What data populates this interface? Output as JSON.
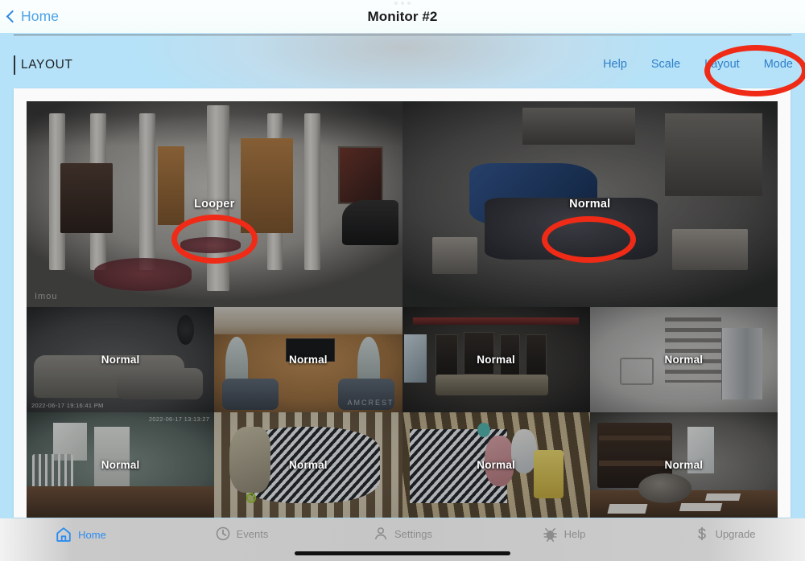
{
  "nav": {
    "back_label": "Home",
    "back_icon": "chevron-left-icon",
    "title": "Monitor #2"
  },
  "toolbar": {
    "section_label": "LAYOUT",
    "links": [
      {
        "label": "Help",
        "name": "help"
      },
      {
        "label": "Scale",
        "name": "scale"
      },
      {
        "label": "Layout",
        "name": "layout"
      },
      {
        "label": "Mode",
        "name": "mode"
      }
    ]
  },
  "camera_grid": {
    "rows": [
      {
        "height_class": "row-big",
        "tiles": [
          {
            "name": "camera-tile-foyer",
            "label": "Looper",
            "scene": "sc-foyer",
            "watermark": "Imou",
            "watermark_pos": "wm-bl",
            "corner_text": "",
            "corner_pos": "ts-tr"
          },
          {
            "name": "camera-tile-bedroom",
            "label": "Normal",
            "scene": "sc-bedroom",
            "watermark": "",
            "watermark_pos": "wm-bl",
            "corner_text": "",
            "corner_pos": "ts-tr"
          }
        ]
      },
      {
        "height_class": "row-sm",
        "tiles": [
          {
            "name": "camera-tile-living-room-gray",
            "label": "Normal",
            "scene": "sc-livgray",
            "watermark": "",
            "watermark_pos": "wm-bl",
            "corner_text": "2022-06-17 19:16:41 PM",
            "corner_pos": "ts-bl"
          },
          {
            "name": "camera-tile-family-room",
            "label": "Normal",
            "scene": "sc-tan",
            "watermark": "AMCREST",
            "watermark_pos": "wm-br",
            "corner_text": "",
            "corner_pos": "ts-bl"
          },
          {
            "name": "camera-tile-dining-room",
            "label": "Normal",
            "scene": "sc-dark",
            "watermark": "",
            "watermark_pos": "wm-bl",
            "corner_text": "",
            "corner_pos": "ts-tr"
          },
          {
            "name": "camera-tile-garage",
            "label": "Normal",
            "scene": "sc-garage",
            "watermark": "",
            "watermark_pos": "wm-bl",
            "corner_text": "",
            "corner_pos": "ts-tr"
          }
        ]
      },
      {
        "height_class": "row-sm",
        "tiles": [
          {
            "name": "camera-tile-nursery",
            "label": "Normal",
            "scene": "sc-nursery",
            "watermark": "",
            "watermark_pos": "wm-bl",
            "corner_text": "2022-06-17 13:13:27",
            "corner_pos": "ts-tr"
          },
          {
            "name": "camera-tile-crib-one",
            "label": "Normal",
            "scene": "sc-crib",
            "watermark": "",
            "watermark_pos": "wm-bl",
            "corner_text": "",
            "corner_pos": "ts-tr"
          },
          {
            "name": "camera-tile-crib-two",
            "label": "Normal",
            "scene": "sc-crib2",
            "watermark": "",
            "watermark_pos": "wm-bl",
            "corner_text": "",
            "corner_pos": "ts-tr"
          },
          {
            "name": "camera-tile-bunk-room",
            "label": "Normal",
            "scene": "sc-bunk",
            "watermark": "",
            "watermark_pos": "wm-tr",
            "corner_text": "",
            "corner_pos": "ts-tr"
          }
        ]
      }
    ]
  },
  "annotations": {
    "color": "#ef2b17",
    "targets": [
      "Mode",
      "Looper",
      "Normal"
    ]
  },
  "tabbar": {
    "items": [
      {
        "label": "Home",
        "icon": "home-icon",
        "active": true
      },
      {
        "label": "Events",
        "icon": "clock-icon",
        "active": false
      },
      {
        "label": "Settings",
        "icon": "person-icon",
        "active": false
      },
      {
        "label": "Help",
        "icon": "bug-icon",
        "active": false
      },
      {
        "label": "Upgrade",
        "icon": "dollar-icon",
        "active": false
      }
    ]
  }
}
